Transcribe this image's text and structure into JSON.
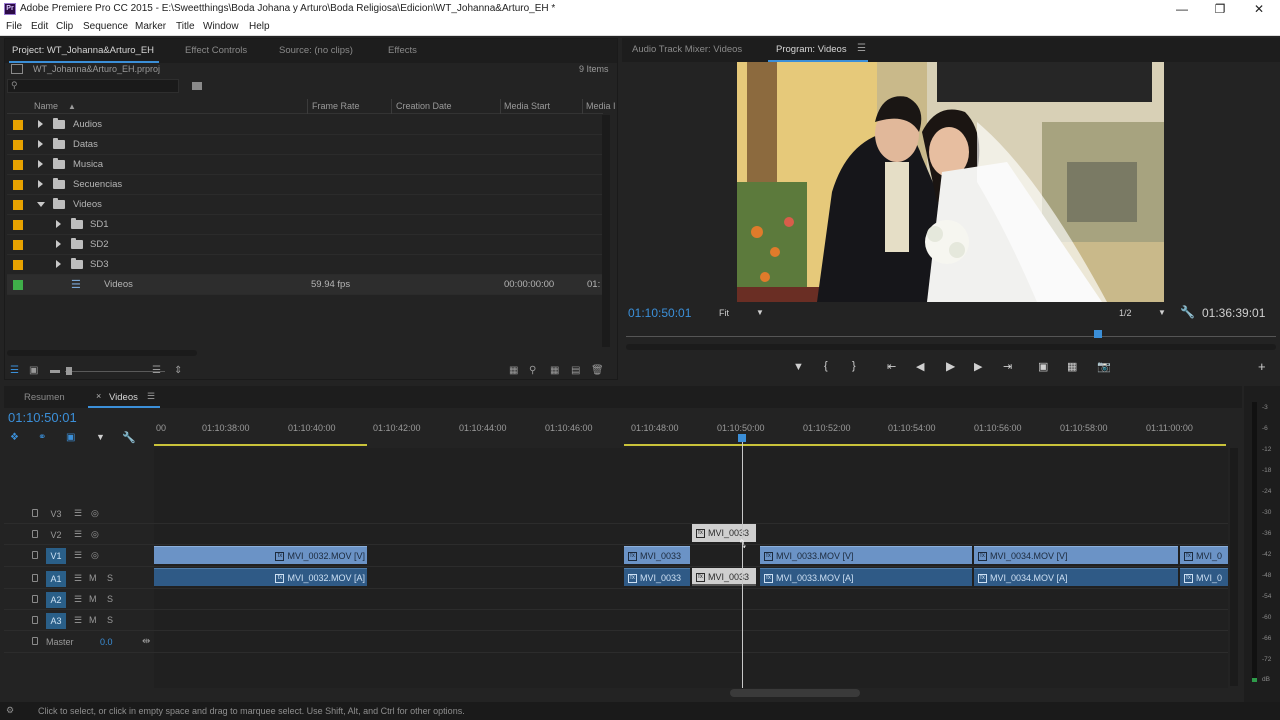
{
  "window": {
    "title": "Adobe Premiere Pro CC 2015 - E:\\Sweetthings\\Boda Johana y Arturo\\Boda Religiosa\\Edicion\\WT_Johanna&Arturo_EH *",
    "app_icon": "Pr"
  },
  "menu": [
    "File",
    "Edit",
    "Clip",
    "Sequence",
    "Marker",
    "Title",
    "Window",
    "Help"
  ],
  "project_panel": {
    "tabs": [
      "Project: WT_Johanna&Arturo_EH",
      "Effect Controls",
      "Source: (no clips)",
      "Effects"
    ],
    "file": "WT_Johanna&Arturo_EH.prproj",
    "item_count": "9 Items",
    "columns": [
      "Name",
      "Frame Rate",
      "Creation Date",
      "Media Start",
      "Media I"
    ],
    "rows": [
      {
        "label": "Audios",
        "color": "#e8a200",
        "type": "folder",
        "expanded": false,
        "indent": 0
      },
      {
        "label": "Datas",
        "color": "#e8a200",
        "type": "folder",
        "expanded": false,
        "indent": 0
      },
      {
        "label": "Musica",
        "color": "#e8a200",
        "type": "folder",
        "expanded": false,
        "indent": 0
      },
      {
        "label": "Secuencias",
        "color": "#e8a200",
        "type": "folder",
        "expanded": false,
        "indent": 0
      },
      {
        "label": "Videos",
        "color": "#e8a200",
        "type": "folder",
        "expanded": true,
        "indent": 0
      },
      {
        "label": "SD1",
        "color": "#e8a200",
        "type": "folder",
        "expanded": false,
        "indent": 1
      },
      {
        "label": "SD2",
        "color": "#e8a200",
        "type": "folder",
        "expanded": false,
        "indent": 1
      },
      {
        "label": "SD3",
        "color": "#e8a200",
        "type": "folder",
        "expanded": false,
        "indent": 1
      },
      {
        "label": "Videos",
        "color": "#3fae49",
        "type": "sequence",
        "frame_rate": "59.94 fps",
        "media_start": "00:00:00:00",
        "media_end": "01:",
        "indent": 1
      }
    ]
  },
  "program_panel": {
    "tabs": [
      "Audio Track Mixer: Videos",
      "Program: Videos"
    ],
    "timecode_current": "01:10:50:01",
    "fit": "Fit",
    "resolution": "1/2",
    "timecode_duration": "01:36:39:01"
  },
  "timeline": {
    "tabs": [
      "Resumen",
      "Videos"
    ],
    "timecode": "01:10:50:01",
    "ruler": [
      "00",
      "01:10:38:00",
      "01:10:40:00",
      "01:10:42:00",
      "01:10:44:00",
      "01:10:46:00",
      "01:10:48:00",
      "01:10:50:00",
      "01:10:52:00",
      "01:10:54:00",
      "01:10:56:00",
      "01:10:58:00",
      "01:11:00:00"
    ],
    "tracks": [
      {
        "name": "V3",
        "on": false
      },
      {
        "name": "V2",
        "on": false
      },
      {
        "name": "V1",
        "on": true
      },
      {
        "name": "A1",
        "on": true
      },
      {
        "name": "A2",
        "on": true
      },
      {
        "name": "A3",
        "on": true
      }
    ],
    "master_label": "Master",
    "master_value": "0.0",
    "clips": {
      "v2_sel": "MVI_0033",
      "v1": [
        "MVI_0032.MOV [V]",
        "MVI_0033",
        "MVI_0033.MOV [V]",
        "MVI_0034.MOV [V]",
        "MVI_0"
      ],
      "a1": [
        "MVI_0032.MOV [A]",
        "MVI_0033",
        "MVI_0033",
        "MVI_0033.MOV [A]",
        "MVI_0034.MOV [A]",
        "MVI_0"
      ]
    }
  },
  "meter_ticks": [
    "-3",
    "-6",
    "-12",
    "-18",
    "-24",
    "-30",
    "-36",
    "-42",
    "-48",
    "-54",
    "-60",
    "-66",
    "-72",
    "dB"
  ],
  "status": "Click to select, or click in empty space and drag to marquee select. Use Shift, Alt, and Ctrl for other options."
}
